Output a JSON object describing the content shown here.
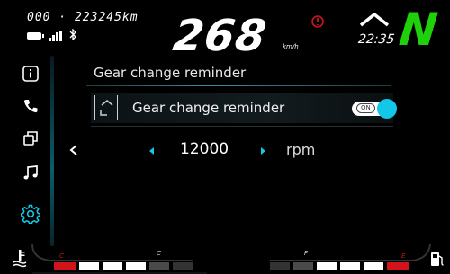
{
  "top": {
    "odometer": "000 · 223245km",
    "speed": "268",
    "speed_unit": "km/h",
    "clock": "22:35",
    "gear": "N"
  },
  "side_menu": {
    "items": [
      {
        "icon": "info-icon"
      },
      {
        "icon": "phone-icon"
      },
      {
        "icon": "apps-icon"
      },
      {
        "icon": "music-icon"
      },
      {
        "icon": "settings-icon",
        "active": true
      }
    ]
  },
  "panel": {
    "title": "Gear change reminder",
    "setting_label": "Gear change reminder",
    "toggle_label": "ON",
    "toggle_on": true,
    "value": "12000",
    "unit": "rpm"
  },
  "bottom": {
    "fuel_label": "F",
    "temp_label": "C",
    "fuel_label_right": "F",
    "empty_label": "E"
  },
  "colors": {
    "accent": "#14c8e6",
    "gear": "#1ed10a",
    "warning": "#d1131c"
  }
}
